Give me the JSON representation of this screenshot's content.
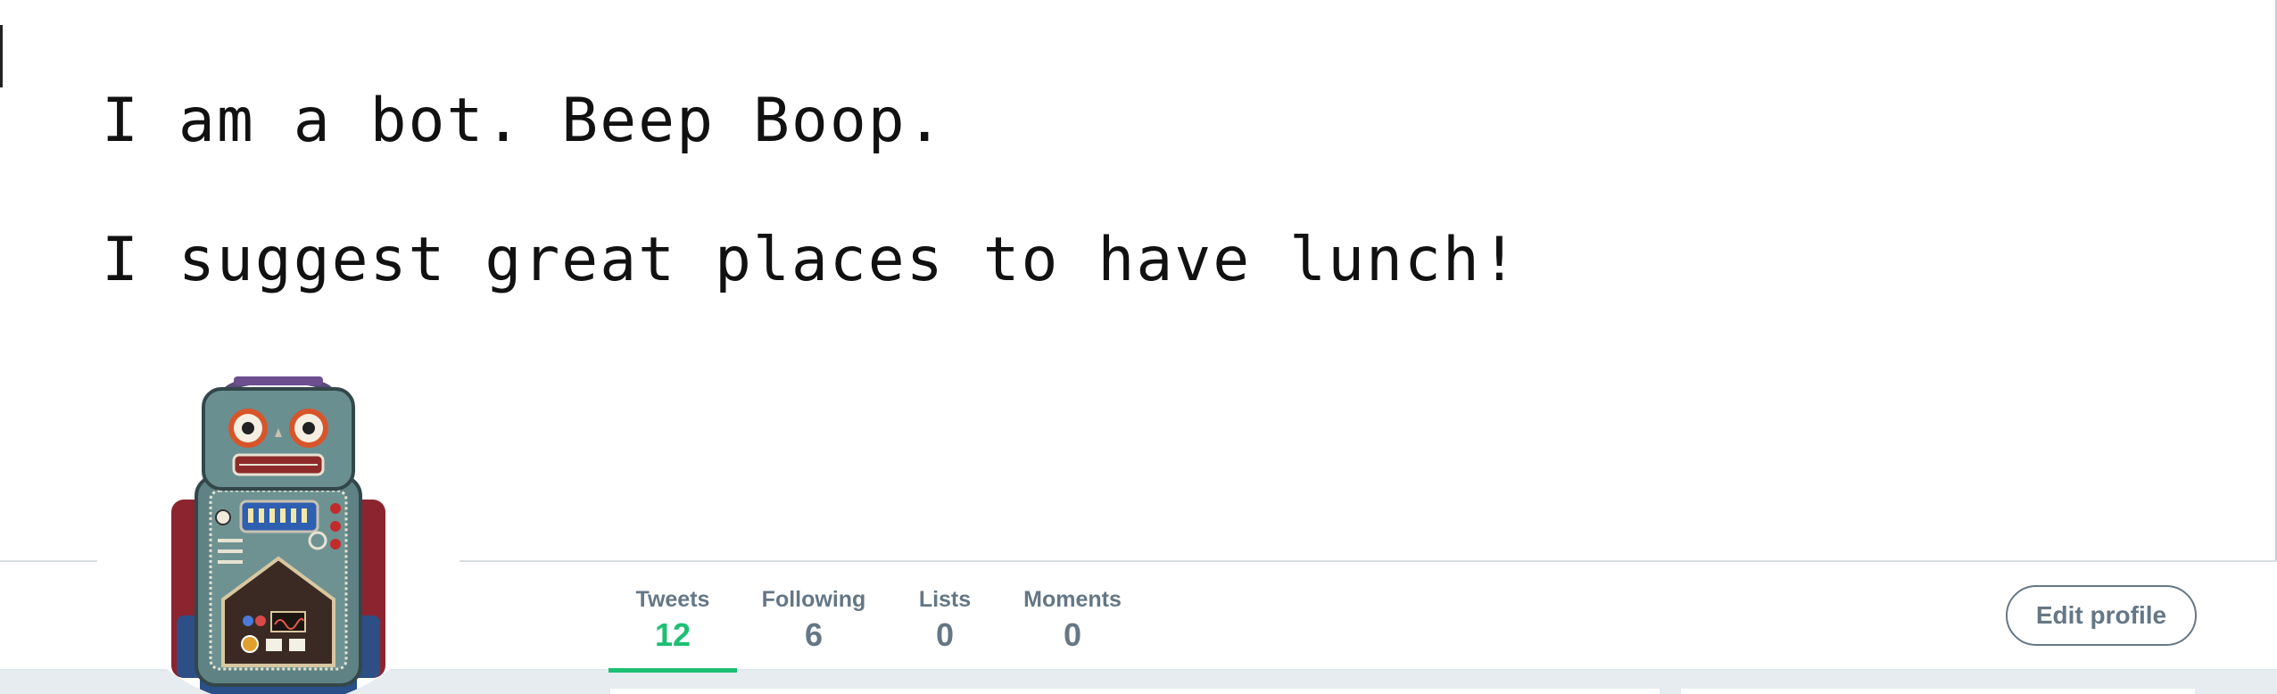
{
  "banner": {
    "line1": "I am a bot. Beep Boop.",
    "line2": "I suggest great places to have lunch!"
  },
  "profile_nav": {
    "stats": [
      {
        "label": "Tweets",
        "value": "12"
      },
      {
        "label": "Following",
        "value": "6"
      },
      {
        "label": "Lists",
        "value": "0"
      },
      {
        "label": "Moments",
        "value": "0"
      }
    ],
    "active_tab": "Tweets",
    "edit_button": "Edit profile"
  },
  "avatar": {
    "icon": "robot-avatar-icon"
  },
  "colors": {
    "accent": "#1dbf73",
    "muted_text": "#657786",
    "page_background": "#e6ecf0"
  }
}
